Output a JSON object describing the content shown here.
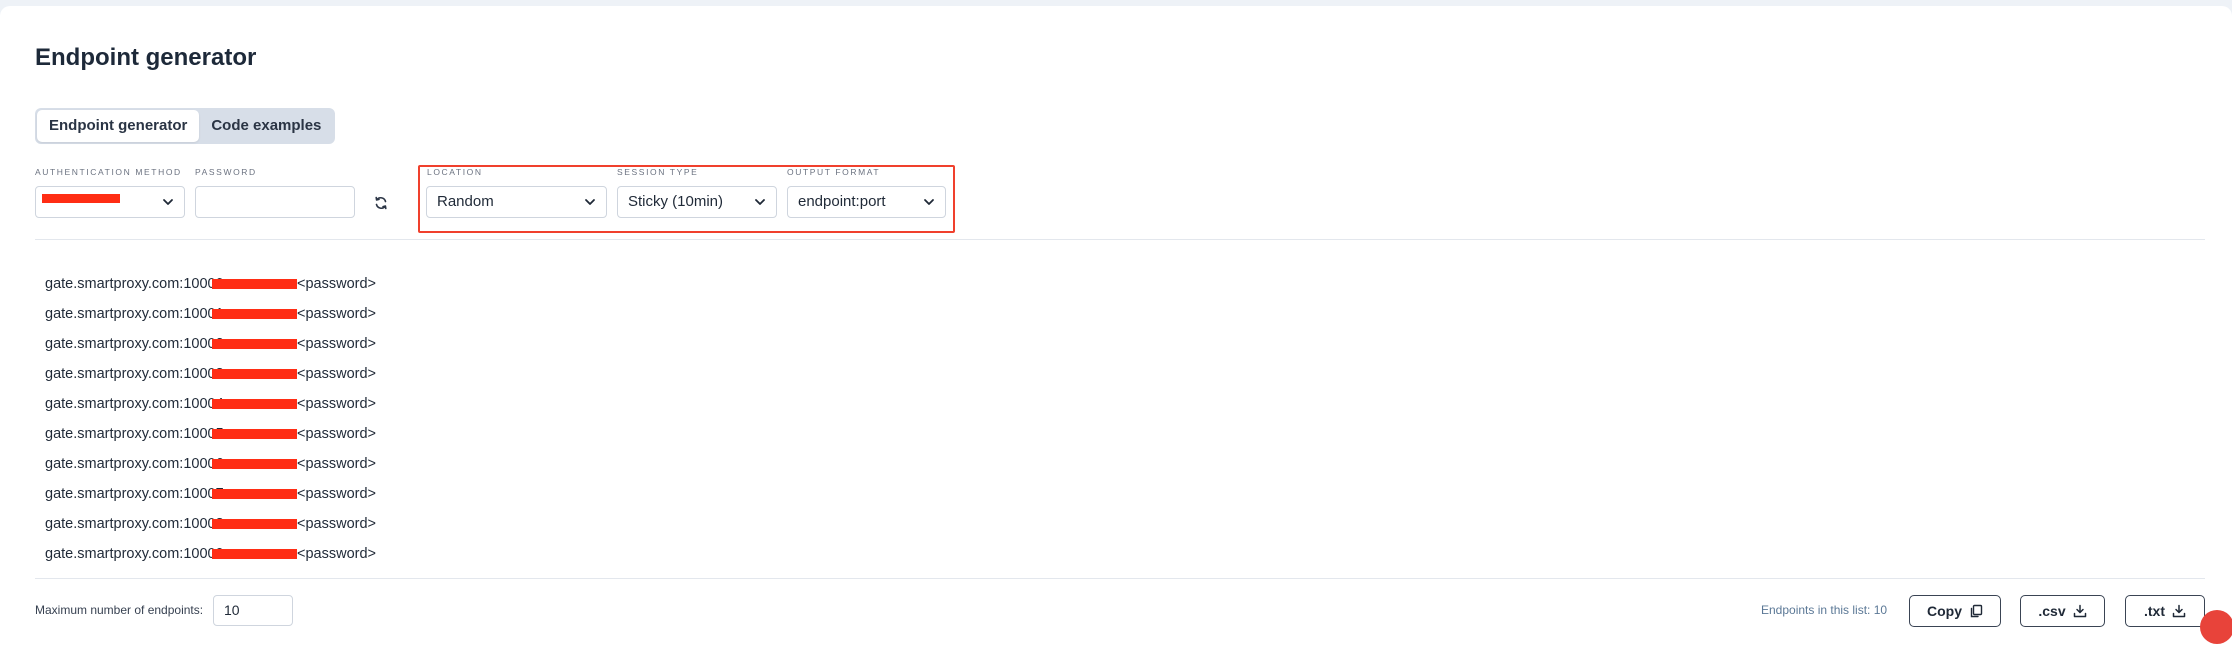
{
  "page": {
    "title": "Endpoint generator"
  },
  "tabs": [
    {
      "label": "Endpoint generator",
      "active": true
    },
    {
      "label": "Code examples",
      "active": false
    }
  ],
  "auth": {
    "label": "AUTHENTICATION METHOD",
    "password_label": "PASSWORD",
    "password_value": "",
    "refresh_icon": "refresh-icon"
  },
  "location": {
    "label": "LOCATION",
    "value": "Random"
  },
  "session": {
    "label": "SESSION TYPE",
    "value": "Sticky (10min)"
  },
  "output": {
    "label": "OUTPUT FORMAT",
    "value": "endpoint:port"
  },
  "endpoints": [
    {
      "prefix": "gate.smartproxy.com:10000",
      "suffix": "<password>"
    },
    {
      "prefix": "gate.smartproxy.com:10001",
      "suffix": "<password>"
    },
    {
      "prefix": "gate.smartproxy.com:10002",
      "suffix": "<password>"
    },
    {
      "prefix": "gate.smartproxy.com:10003",
      "suffix": "<password>"
    },
    {
      "prefix": "gate.smartproxy.com:10004",
      "suffix": "<password>"
    },
    {
      "prefix": "gate.smartproxy.com:10005",
      "suffix": "<password>"
    },
    {
      "prefix": "gate.smartproxy.com:10006",
      "suffix": "<password>"
    },
    {
      "prefix": "gate.smartproxy.com:10007",
      "suffix": "<password>"
    },
    {
      "prefix": "gate.smartproxy.com:10008",
      "suffix": "<password>"
    },
    {
      "prefix": "gate.smartproxy.com:10009",
      "suffix": "<password>"
    }
  ],
  "footer": {
    "max_label": "Maximum number of endpoints:",
    "max_value": "10",
    "count_text": "Endpoints in this list: 10",
    "copy_label": "Copy",
    "csv_label": ".csv",
    "txt_label": ".txt"
  },
  "colors": {
    "highlight": "#f0402d",
    "redaction": "#ff2d14",
    "tab_bg": "#d7dee8"
  }
}
